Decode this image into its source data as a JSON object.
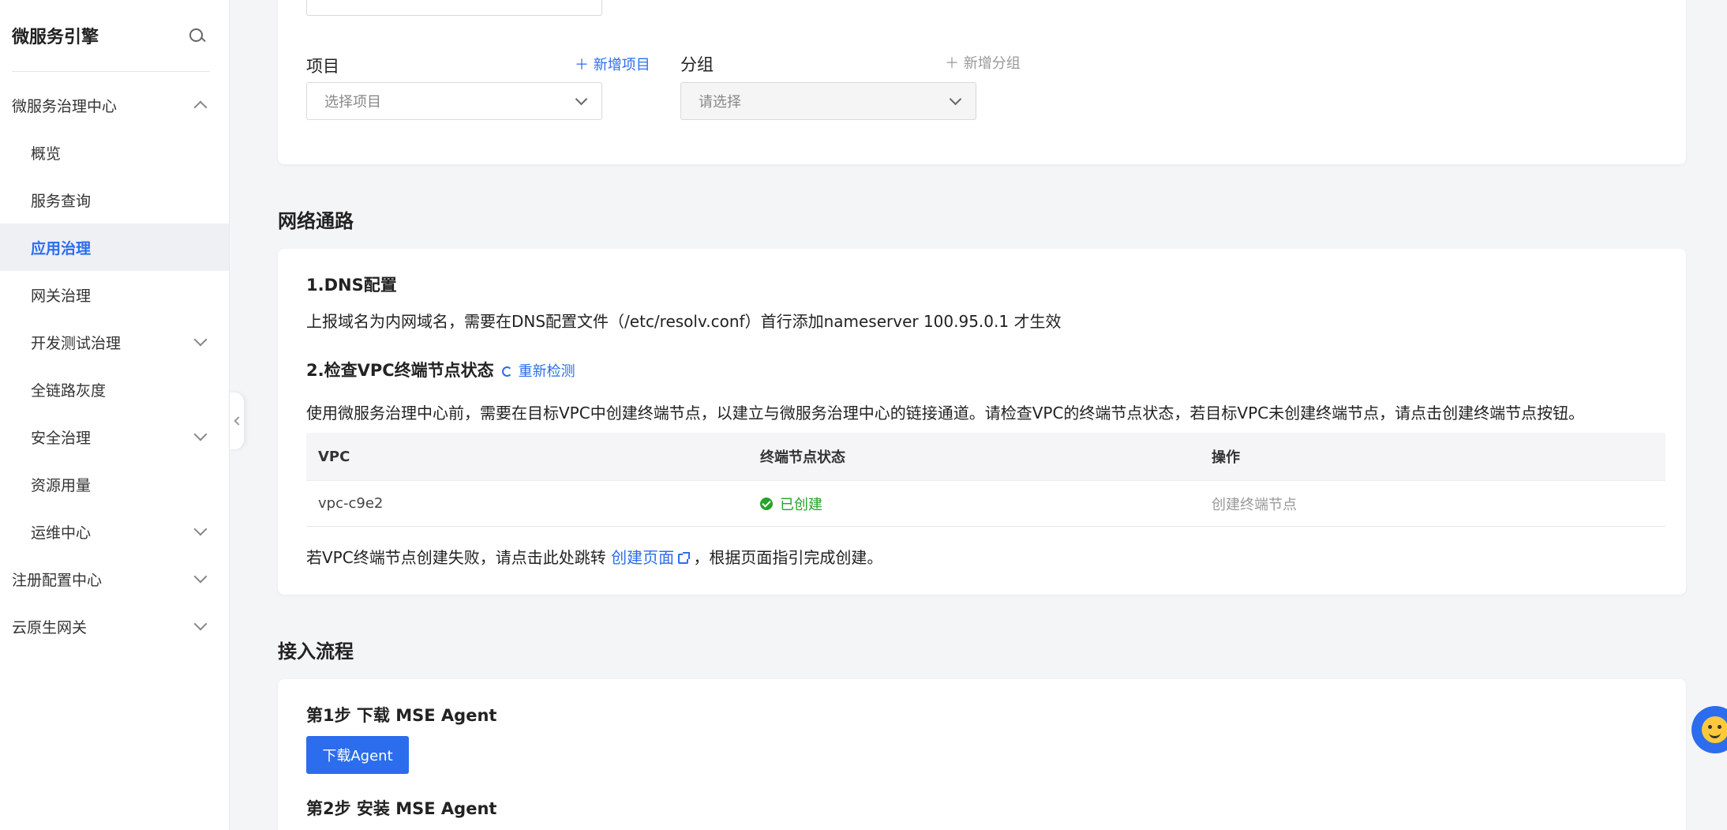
{
  "sidebar": {
    "title": "微服务引擎",
    "items": [
      {
        "label": "微服务治理中心",
        "level": "top",
        "expanded": true
      },
      {
        "label": "概览",
        "level": "sub"
      },
      {
        "label": "服务查询",
        "level": "sub"
      },
      {
        "label": "应用治理",
        "level": "sub",
        "active": true
      },
      {
        "label": "网关治理",
        "level": "sub"
      },
      {
        "label": "开发测试治理",
        "level": "sub",
        "collapsible": true
      },
      {
        "label": "全链路灰度",
        "level": "sub"
      },
      {
        "label": "安全治理",
        "level": "sub",
        "collapsible": true
      },
      {
        "label": "资源用量",
        "level": "sub"
      },
      {
        "label": "运维中心",
        "level": "sub",
        "collapsible": true
      },
      {
        "label": "注册配置中心",
        "level": "top",
        "collapsible": true
      },
      {
        "label": "云原生网关",
        "level": "top",
        "collapsible": true
      }
    ]
  },
  "form": {
    "project_label": "项目",
    "project_add": "新增项目",
    "project_placeholder": "选择项目",
    "group_label": "分组",
    "group_add": "新增分组",
    "group_placeholder": "请选择"
  },
  "network": {
    "section_title": "网络通路",
    "dns_title": "1.DNS配置",
    "dns_text": "上报域名为内网域名，需要在DNS配置文件（/etc/resolv.conf）首行添加nameserver 100.95.0.1 才生效",
    "vpc_title": "2.检查VPC终端节点状态",
    "recheck": "重新检测",
    "vpc_text": "使用微服务治理中心前，需要在目标VPC中创建终端节点，以建立与微服务治理中心的链接通道。请检查VPC的终端节点状态，若目标VPC未创建终端节点，请点击创建终端节点按钮。",
    "table": {
      "headers": [
        "VPC",
        "终端节点状态",
        "操作"
      ],
      "rows": [
        {
          "vpc": "vpc-c9e2",
          "status": "已创建",
          "action": "创建终端节点"
        }
      ]
    },
    "fail_prefix": "若VPC终端节点创建失败，请点击此处跳转",
    "fail_link": "创建页面",
    "fail_suffix": "，根据页面指引完成创建。"
  },
  "access": {
    "section_title": "接入流程",
    "step1_title": "第1步 下载 MSE Agent",
    "download_button": "下载Agent",
    "step2_title": "第2步 安装 MSE Agent"
  },
  "colors": {
    "primary": "#2c6ded",
    "success": "#27a22a"
  }
}
